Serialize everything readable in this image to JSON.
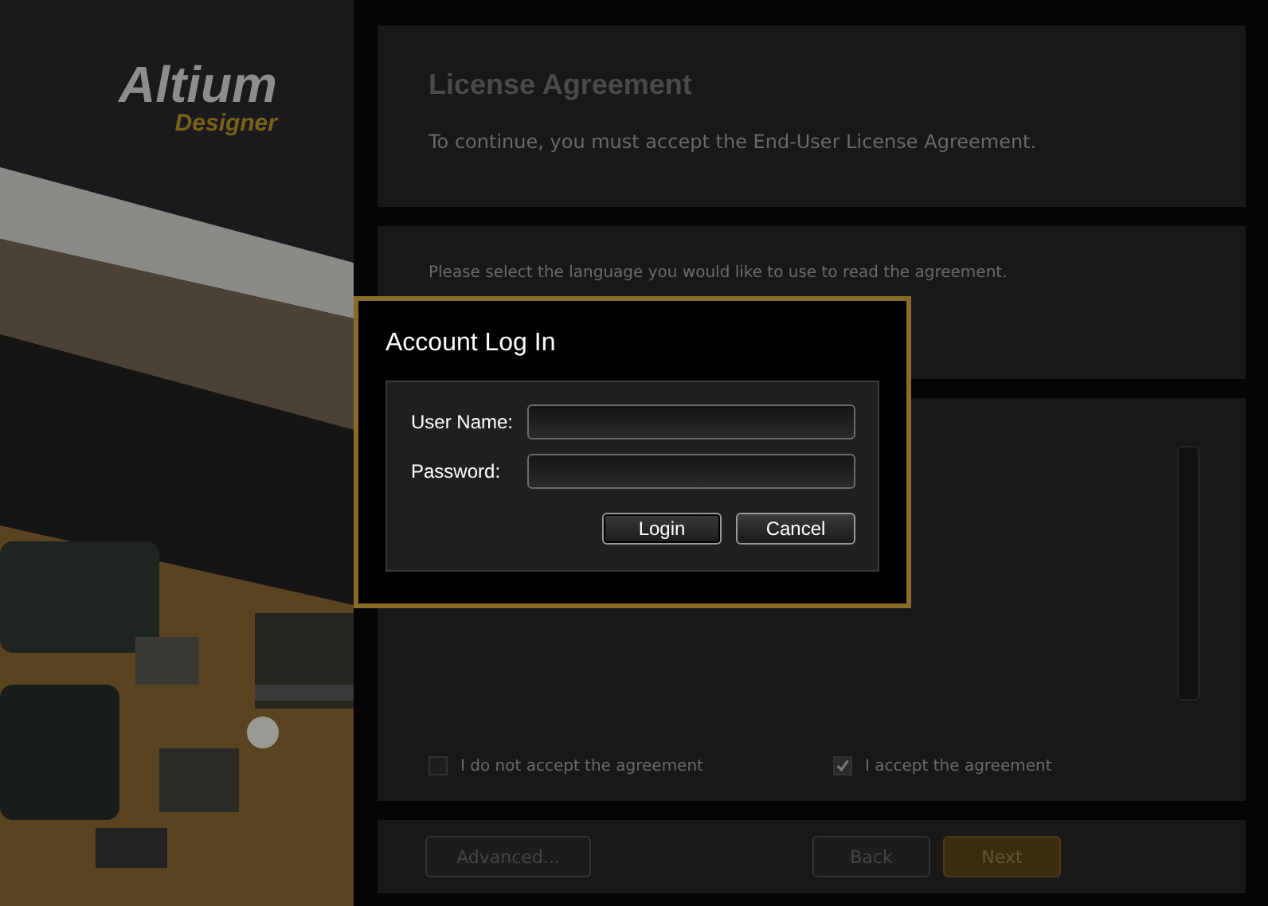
{
  "brand": {
    "name": "Altium",
    "product": "Designer"
  },
  "license": {
    "title": "License Agreement",
    "subtitle": "To continue, you must accept the End-User License Agreement."
  },
  "language": {
    "prompt": "Please select the language you would like to use to read the agreement."
  },
  "choices": [
    {
      "label": "I do not accept the agreement",
      "checked": false
    },
    {
      "label": "I accept the agreement",
      "checked": true
    }
  ],
  "footer": {
    "advanced": "Advanced...",
    "back": "Back",
    "next": "Next"
  },
  "dialog": {
    "title": "Account Log In",
    "fields": [
      {
        "label": "User Name:"
      },
      {
        "label": "Password:"
      }
    ],
    "login": "Login",
    "cancel": "Cancel"
  }
}
